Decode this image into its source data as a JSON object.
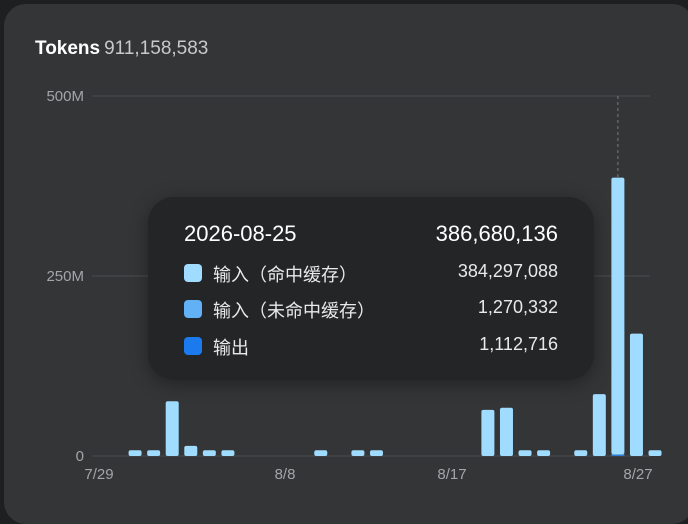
{
  "header": {
    "label": "Tokens",
    "total": "911,158,583"
  },
  "colors": {
    "background": "#333537",
    "bar": "#9fdcff",
    "grid": "#4a4c4f",
    "input_cached": "#9fdcff",
    "input_uncached": "#62b0f5",
    "output": "#1a7aee"
  },
  "chart_data": {
    "type": "bar",
    "stacked": true,
    "x_tick_labels": [
      "7/29",
      "8/8",
      "8/17",
      "8/27"
    ],
    "y_tick_labels": [
      "500M",
      "250M",
      "0"
    ],
    "ylim": [
      0,
      500000000
    ],
    "grid": true,
    "categories": [
      "7/28",
      "7/29",
      "7/30",
      "7/31",
      "8/1",
      "8/2",
      "8/3",
      "8/4",
      "8/5",
      "8/6",
      "8/7",
      "8/8",
      "8/9",
      "8/10",
      "8/11",
      "8/12",
      "8/13",
      "8/14",
      "8/15",
      "8/16",
      "8/17",
      "8/18",
      "8/19",
      "8/20",
      "8/21",
      "8/22",
      "8/23",
      "8/24",
      "8/25",
      "8/26",
      "8/27"
    ],
    "series": [
      {
        "name": "输入（命中缓存）",
        "values": [
          0,
          8000000,
          8000000,
          76000000,
          14000000,
          8000000,
          8000000,
          0,
          0,
          0,
          0,
          8000000,
          0,
          8000000,
          8000000,
          0,
          0,
          0,
          0,
          0,
          64000000,
          67000000,
          8000000,
          8000000,
          0,
          8000000,
          86000000,
          384297088,
          170000000,
          8000000,
          0
        ]
      },
      {
        "name": "输入（未命中缓存）",
        "values": [
          0,
          0,
          0,
          0,
          0,
          0,
          0,
          0,
          0,
          0,
          0,
          0,
          0,
          0,
          0,
          0,
          0,
          0,
          0,
          0,
          0,
          0,
          0,
          0,
          0,
          0,
          0,
          1270332,
          0,
          0,
          0
        ]
      },
      {
        "name": "输出",
        "values": [
          0,
          0,
          0,
          0,
          0,
          0,
          0,
          0,
          0,
          0,
          0,
          0,
          0,
          0,
          0,
          0,
          0,
          0,
          0,
          0,
          0,
          0,
          0,
          0,
          0,
          0,
          0,
          1112716,
          0,
          0,
          0
        ]
      }
    ]
  },
  "tooltip": {
    "date": "2026-08-25",
    "total": "386,680,136",
    "rows": [
      {
        "name": "输入（命中缓存）",
        "value": "384,297,088",
        "color": "#9fdcff"
      },
      {
        "name": "输入（未命中缓存）",
        "value": "1,270,332",
        "color": "#62b0f5"
      },
      {
        "name": "输出",
        "value": "1,112,716",
        "color": "#1a7aee"
      }
    ]
  }
}
